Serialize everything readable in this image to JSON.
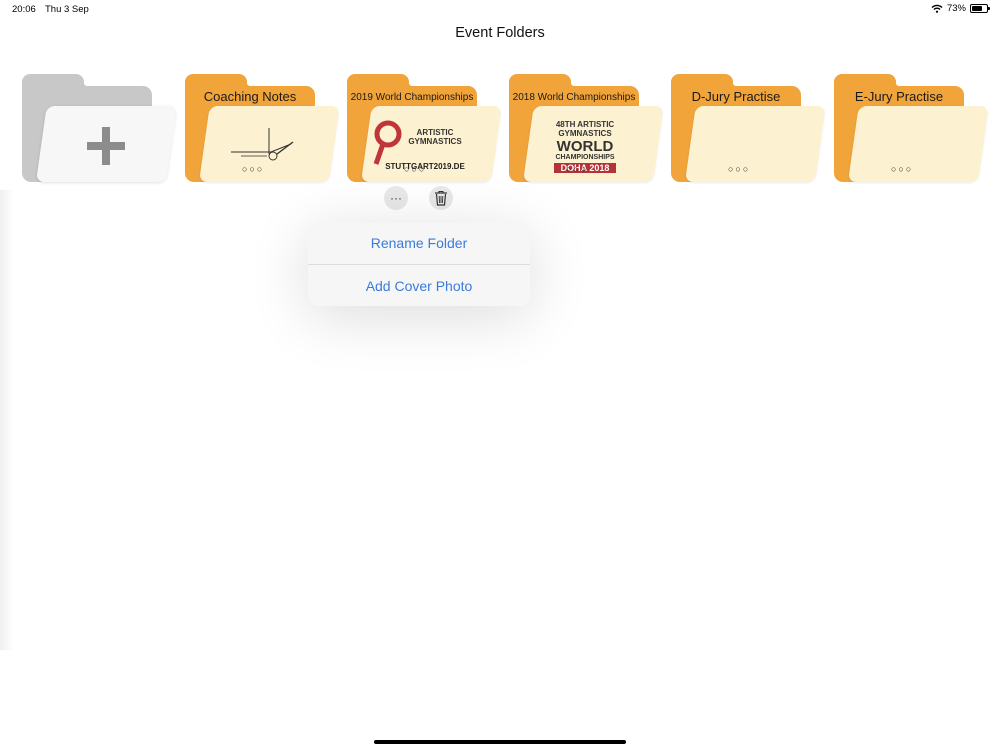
{
  "status_bar": {
    "time": "20:06",
    "date": "Thu 3 Sep",
    "battery": "73%",
    "battery_level": 0.73
  },
  "title": "Event Folders",
  "folders": [
    {
      "label": "",
      "kind": "new",
      "icon": "plus-icon"
    },
    {
      "label": "Coaching Notes",
      "kind": "folder",
      "cover": "drawing"
    },
    {
      "label": "2019 World Championships",
      "kind": "folder",
      "cover": {
        "lines": [
          "ARTISTIC",
          "GYMNASTICS",
          "STUTTGART2019.DE"
        ]
      }
    },
    {
      "label": "2018 World Championships",
      "kind": "folder",
      "cover": {
        "lines": [
          "48TH ARTISTIC",
          "GYMNASTICS",
          "WORLD",
          "CHAMPIONSHIPS",
          "DOHA 2018"
        ]
      }
    },
    {
      "label": "D-Jury Practise",
      "kind": "folder"
    },
    {
      "label": "E-Jury Practise",
      "kind": "folder"
    }
  ],
  "folder_more_glyph": "○○○",
  "actions": {
    "more_glyph": "···",
    "delete_glyph": "🗑"
  },
  "context_menu": {
    "items": [
      {
        "label": "Rename Folder"
      },
      {
        "label": "Add Cover Photo"
      }
    ],
    "accent": "#3A7BDB"
  },
  "colors": {
    "folder": "#F0A43A",
    "folder_front": "#FCF1D0",
    "new_folder": "#C8C8C8"
  }
}
